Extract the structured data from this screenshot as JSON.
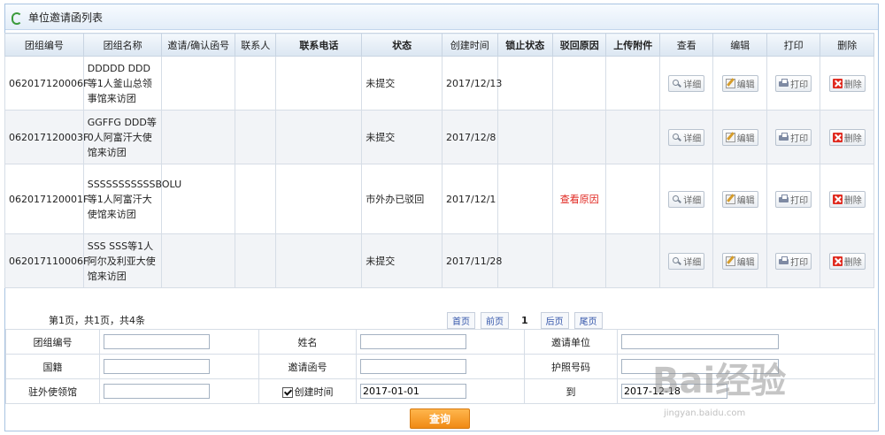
{
  "title": "单位邀请函列表",
  "columns": [
    "团组编号",
    "团组名称",
    "邀请/确认函号",
    "联系人",
    "联系电话",
    "状态",
    "创建时间",
    "锁止状态",
    "驳回原因",
    "上传附件",
    "查看",
    "编辑",
    "打印",
    "删除"
  ],
  "rows": [
    {
      "id": "062017120006F",
      "name": "DDDDD DDD等1人釜山总领事馆来访团",
      "invite_no": "",
      "contact": "",
      "phone": "",
      "status": "未提交",
      "created": "2017/12/13",
      "lock": "",
      "reason": "",
      "attachment": ""
    },
    {
      "id": "062017120003F",
      "name": "GGFFG DDD等0人阿富汗大使馆来访团",
      "invite_no": "",
      "contact": "",
      "phone": "",
      "status": "未提交",
      "created": "2017/12/8",
      "lock": "",
      "reason": "",
      "attachment": ""
    },
    {
      "id": "062017120001F",
      "name": "SSSSSSSSSSSBOLU等1人阿富汗大使馆来访团",
      "invite_no": "",
      "contact": "",
      "phone": "",
      "status": "市外办已驳回",
      "created": "2017/12/1",
      "lock": "",
      "reason": "查看原因",
      "attachment": ""
    },
    {
      "id": "062017110006F",
      "name": "SSS SSS等1人阿尔及利亚大使馆来访团",
      "invite_no": "",
      "contact": "",
      "phone": "",
      "status": "未提交",
      "created": "2017/11/28",
      "lock": "",
      "reason": "",
      "attachment": ""
    }
  ],
  "actions": {
    "view": "详细",
    "edit": "编辑",
    "print": "打印",
    "delete": "删除"
  },
  "pager": {
    "info": "第1页，共1页，共4条",
    "first": "首页",
    "prev": "前页",
    "current": "1",
    "next": "后页",
    "last": "尾页"
  },
  "search": {
    "group_no_label": "团组编号",
    "group_no": "",
    "name_label": "姓名",
    "name": "",
    "unit_label": "邀请单位",
    "unit": "",
    "nationality_label": "国籍",
    "nationality": "",
    "invite_no_label": "邀请函号",
    "invite_no": "",
    "passport_label": "护照号码",
    "passport": "",
    "embassy_label": "驻外使领馆",
    "embassy": "",
    "created_label": "创建时间",
    "created_checked": true,
    "created_from": "2017-01-01",
    "to_label": "到",
    "created_to": "2017-12-18",
    "query_button": "查询"
  },
  "watermark": {
    "main": "Bai经验",
    "sub": "jingyan.baidu.com"
  }
}
